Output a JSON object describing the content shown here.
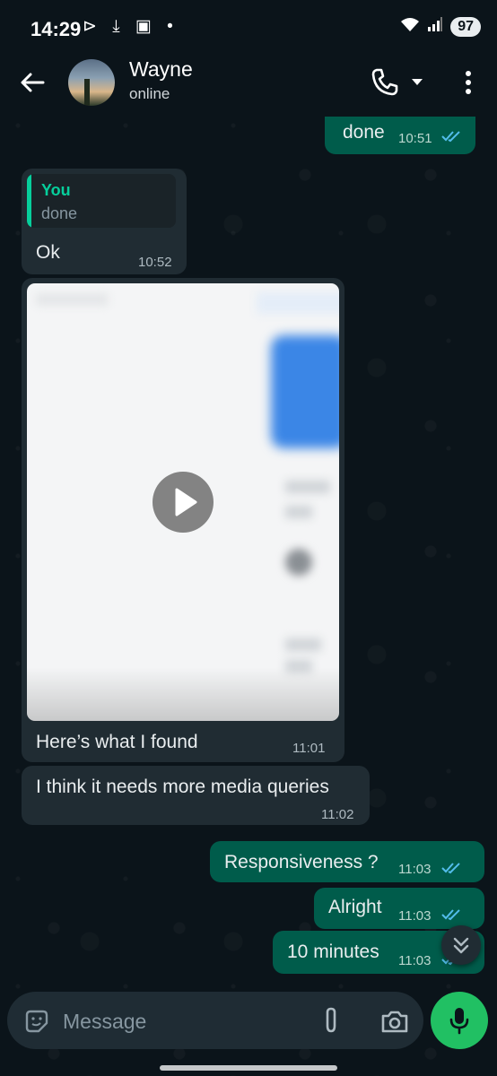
{
  "status_bar": {
    "time": "14:29",
    "battery": "97"
  },
  "header": {
    "contact_name": "Wayne",
    "contact_status": "online"
  },
  "messages": [
    {
      "direction": "out",
      "text": "done",
      "time": "10:51",
      "read": true
    },
    {
      "direction": "in",
      "quote": {
        "author": "You",
        "text": "done"
      },
      "text": "Ok",
      "time": "10:52"
    },
    {
      "direction": "in",
      "type": "video",
      "caption": "Here’s what I found",
      "time": "11:01"
    },
    {
      "direction": "in",
      "text": "I think it needs more media queries",
      "time": "11:02"
    },
    {
      "direction": "out",
      "text": "Responsiveness ?",
      "time": "11:03",
      "read": true
    },
    {
      "direction": "out",
      "text": "Alright",
      "time": "11:03",
      "read": true
    },
    {
      "direction": "out",
      "text": "10 minutes",
      "time": "11:03",
      "read": true
    }
  ],
  "composer": {
    "placeholder": "Message"
  },
  "colors": {
    "background": "#0b141a",
    "incoming_bubble": "#202c33",
    "outgoing_bubble": "#005c4b",
    "read_ticks": "#53bdeb",
    "accent": "#21c063"
  },
  "icons": [
    "back-arrow",
    "voice-call",
    "dropdown",
    "more-vert",
    "play",
    "scroll-down",
    "emoji",
    "attach",
    "camera",
    "mic"
  ]
}
